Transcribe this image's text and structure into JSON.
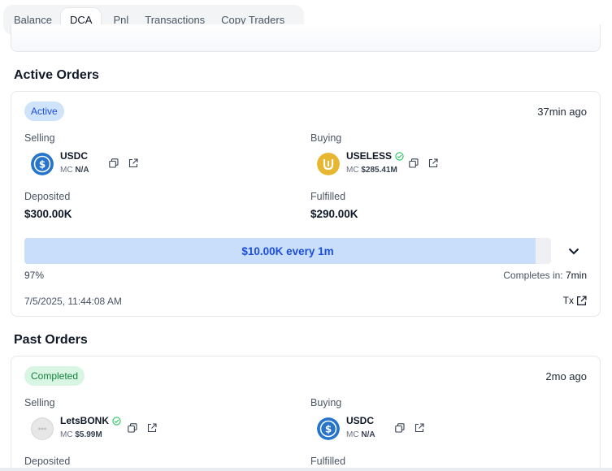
{
  "tabs": [
    {
      "label": "Balance",
      "active": false
    },
    {
      "label": "DCA",
      "active": true
    },
    {
      "label": "Pnl",
      "active": false
    },
    {
      "label": "Transactions",
      "active": false
    },
    {
      "label": "Copy Traders",
      "active": false
    }
  ],
  "active_section": {
    "title": "Active Orders",
    "order": {
      "status": "Active",
      "time_ago": "37min ago",
      "selling_label": "Selling",
      "selling": {
        "symbol": "USDC",
        "mc_prefix": "MC",
        "mc": "N/A",
        "icon": "usdc-icon",
        "verified": false
      },
      "buying_label": "Buying",
      "buying": {
        "symbol": "USELESS",
        "mc_prefix": "MC",
        "mc": "$285.41M",
        "icon": "useless-token-icon",
        "verified": true
      },
      "deposited_label": "Deposited",
      "deposited": "$300.00K",
      "fulfilled_label": "Fulfilled",
      "fulfilled": "$290.00K",
      "progress_fraction": 0.97,
      "progress_text": "$10.00K every 1m",
      "percent_label": "97%",
      "completes_prefix": "Completes in:",
      "completes_value": "7min",
      "timestamp": "7/5/2025, 11:44:08 AM",
      "tx_label": "Tx"
    }
  },
  "past_section": {
    "title": "Past Orders",
    "order": {
      "status": "Completed",
      "time_ago": "2mo ago",
      "selling_label": "Selling",
      "selling": {
        "symbol": "LetsBONK",
        "mc_prefix": "MC",
        "mc": "$5.99M",
        "icon": "letsbonk-token-icon",
        "verified": true
      },
      "buying_label": "Buying",
      "buying": {
        "symbol": "USDC",
        "mc_prefix": "MC",
        "mc": "N/A",
        "icon": "usdc-icon",
        "verified": false
      },
      "deposited_label": "Deposited",
      "fulfilled_label": "Fulfilled"
    }
  },
  "colors": {
    "accent_blue": "#1d4ed8",
    "progress_fill": "#c9defa",
    "active_badge_bg": "#cfe3fb",
    "completed_badge_bg": "#d9f5e3",
    "completed_text": "#15803d",
    "verified_green": "#22c55e",
    "usdc_blue": "#2775ca",
    "useless_gold": "#e8b731"
  }
}
